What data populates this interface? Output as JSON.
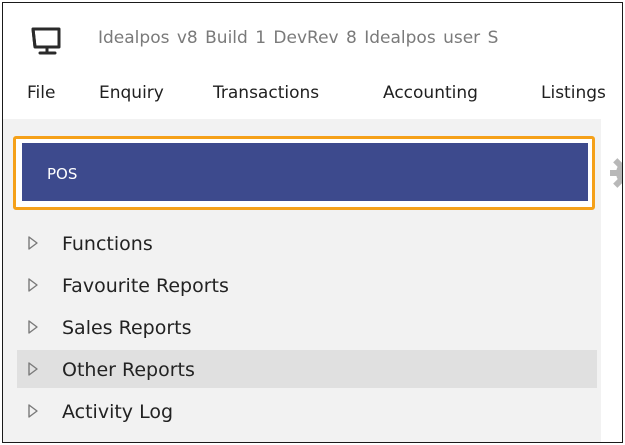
{
  "window": {
    "app_icon": "monitor-icon",
    "title": "Idealpos v8 Build 1 DevRev 8   Idealpos user   S"
  },
  "menu": {
    "items": [
      {
        "label": "File"
      },
      {
        "label": "Enquiry"
      },
      {
        "label": "Transactions"
      },
      {
        "label": "Accounting"
      },
      {
        "label": "Listings"
      }
    ]
  },
  "nav": {
    "selected": {
      "label": "POS"
    },
    "items": [
      {
        "label": "Functions",
        "icon": "expand-arrow-icon"
      },
      {
        "label": "Favourite Reports",
        "icon": "expand-arrow-icon"
      },
      {
        "label": "Sales Reports",
        "icon": "expand-arrow-icon"
      },
      {
        "label": "Other Reports",
        "icon": "expand-arrow-icon"
      },
      {
        "label": "Activity Log",
        "icon": "expand-arrow-icon"
      }
    ]
  },
  "settings_icon": "gear-icon",
  "colors": {
    "selected_bg": "#3d4a8d",
    "focus_outline": "#f5a11a",
    "nav_bg": "#f2f2f2",
    "hover_bg": "#e0e0e0"
  }
}
